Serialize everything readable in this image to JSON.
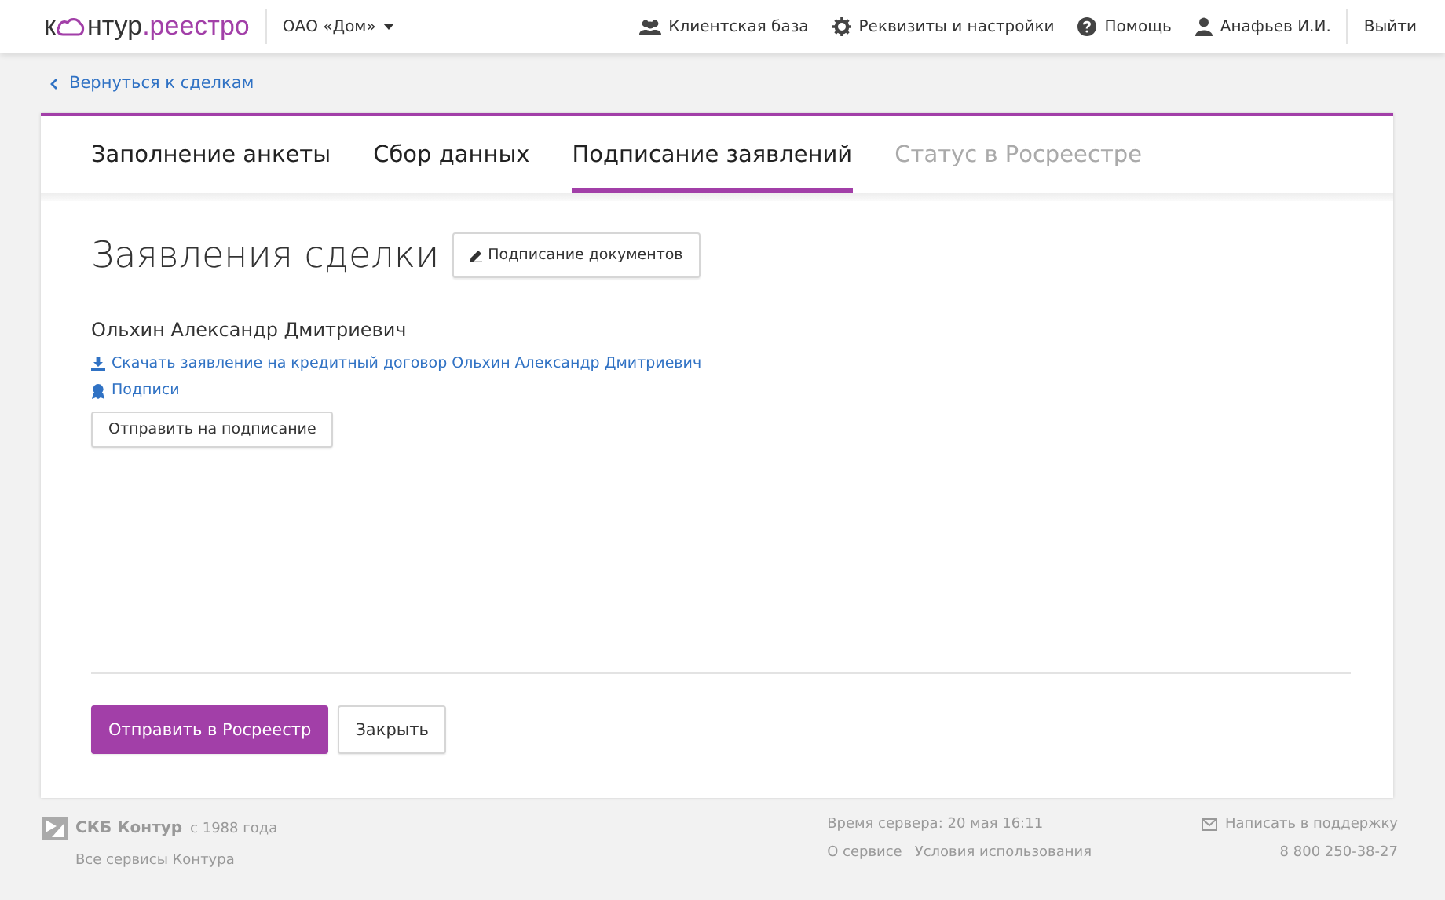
{
  "header": {
    "logo": {
      "before": "к",
      "after": "нтур",
      "suffix": ".реестро"
    },
    "org": "ОАО «Дом»",
    "nav": [
      {
        "kind": "clients",
        "label": "Клиентская база"
      },
      {
        "kind": "settings",
        "label": "Реквизиты и настройки"
      },
      {
        "kind": "help",
        "label": "Помощь"
      },
      {
        "kind": "user",
        "label": "Анафьев И.И."
      }
    ],
    "logout": "Выйти"
  },
  "back_link": "Вернуться к сделкам",
  "tabs": [
    {
      "label": "Заполнение анкеты",
      "selected": false,
      "disabled": false
    },
    {
      "label": "Сбор данных",
      "selected": false,
      "disabled": false
    },
    {
      "label": "Подписание заявлений",
      "selected": true,
      "disabled": false
    },
    {
      "label": "Статус в Росреестре",
      "selected": false,
      "disabled": true
    }
  ],
  "title": "Заявления сделки",
  "sign_button": "Подписание документов",
  "person": {
    "name": "Ольхин Александр Дмитриевич",
    "links": [
      {
        "kind": "download",
        "label": "Скачать заявление на кредитный договор Ольхин Александр Дмитриевич"
      },
      {
        "kind": "signatures",
        "label": "Подписи"
      }
    ],
    "send_button": "Отправить на подписание"
  },
  "actions": {
    "primary": "Отправить в Росреестр",
    "secondary": "Закрыть"
  },
  "footer": {
    "company": "СКБ Контур",
    "since": "с 1988 года",
    "services": "Все сервисы Контура",
    "server_time": "Время сервера: 20 мая 16:11",
    "links": [
      "О сервисе",
      "Условия использования"
    ],
    "support": "Написать в поддержку",
    "phone": "8 800 250-38-27"
  }
}
